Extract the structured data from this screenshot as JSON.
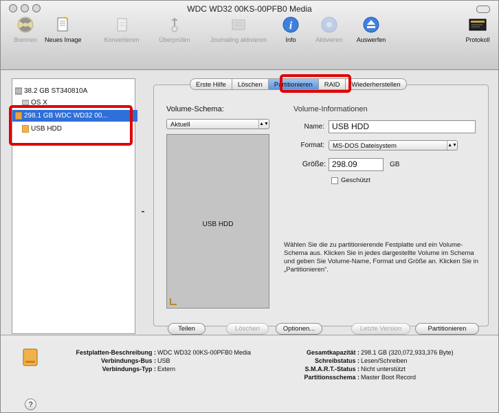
{
  "window": {
    "title": "WDC WD32 00KS-00PFB0 Media"
  },
  "toolbar": [
    {
      "label": "Brennen",
      "icon": "burn-icon",
      "enabled": false
    },
    {
      "label": "Neues Image",
      "icon": "new-image-icon",
      "enabled": true
    },
    {
      "label": "Konvertieren",
      "icon": "convert-icon",
      "enabled": false
    },
    {
      "label": "Überprüfen",
      "icon": "verify-icon",
      "enabled": false
    },
    {
      "label": "Journaling aktivieren",
      "icon": "journaling-icon",
      "enabled": false
    },
    {
      "label": "Info",
      "icon": "info-icon",
      "enabled": true
    },
    {
      "label": "Aktivieren",
      "icon": "mount-icon",
      "enabled": false
    },
    {
      "label": "Auswerfen",
      "icon": "eject-icon",
      "enabled": true
    },
    {
      "label": "Protokoll",
      "icon": "log-icon",
      "enabled": true
    }
  ],
  "sidebar": {
    "items": [
      {
        "label": "38.2 GB ST340810A",
        "icon": "hard-disk-icon",
        "selected": false
      },
      {
        "label": "OS X",
        "icon": "volume-icon",
        "selected": false
      },
      {
        "label": "298.1 GB WDC WD32 00...",
        "icon": "external-disk-icon",
        "selected": true
      },
      {
        "label": "USB HDD",
        "icon": "external-volume-icon",
        "selected": false
      }
    ]
  },
  "tabs": [
    {
      "label": "Erste Hilfe",
      "active": false
    },
    {
      "label": "Löschen",
      "active": false
    },
    {
      "label": "Partitionieren",
      "active": true
    },
    {
      "label": "RAID",
      "active": false
    },
    {
      "label": "Wiederherstellen",
      "active": false
    }
  ],
  "partition": {
    "scheme_label": "Volume-Schema:",
    "scheme_value": "Aktuell",
    "info_label": "Volume-Informationen",
    "name_label": "Name:",
    "name_value": "USB HDD",
    "format_label": "Format:",
    "format_value": "MS-DOS Dateisystem",
    "size_label": "Größe:",
    "size_value": "298.09",
    "size_unit": "GB",
    "protected_label": "Geschützt",
    "protected_checked": false,
    "volume_name": "USB HDD",
    "help_text": "Wählen Sie die zu partitionierende Festplatte und ein Volume-Schema aus. Klicken Sie in jedes dargestellte Volume im Schema und geben Sie Volume-Name, Format und Größe an. Klicken Sie in „Partitionieren“."
  },
  "buttons": {
    "split": "Teilen",
    "delete": "Löschen",
    "options": "Optionen...",
    "revert": "Letzte Version",
    "partition": "Partitionieren"
  },
  "disk_info": {
    "desc_label": "Festplatten-Beschreibung :",
    "desc_value": "WDC WD32 00KS-00PFB0 Media",
    "bus_label": "Verbindungs-Bus :",
    "bus_value": "USB",
    "type_label": "Verbindungs-Typ :",
    "type_value": "Extern",
    "capacity_label": "Gesamtkapazität :",
    "capacity_value": "298.1 GB (320,072,933,376 Byte)",
    "write_label": "Schreibstatus :",
    "write_value": "Lesen/Schreiben",
    "smart_label": "S.M.A.R.T.-Status :",
    "smart_value": "Nicht unterstützt",
    "scheme_label": "Partitionsschema :",
    "scheme_value": "Master Boot Record"
  },
  "colors": {
    "selection": "#2f6fd8",
    "highlight": "#e00000",
    "active_tab": "#5b93e0",
    "scheme_fill": "#c4c4c4"
  }
}
